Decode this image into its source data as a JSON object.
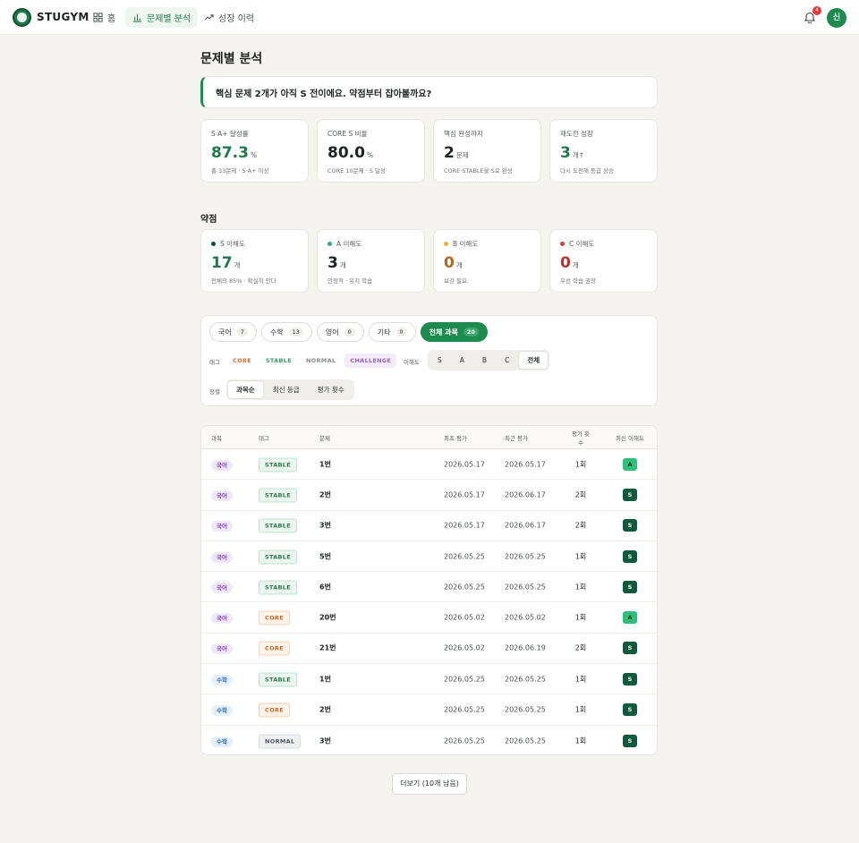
{
  "app": {
    "brand": "STUGYM",
    "notifications": "4",
    "avatar": "신"
  },
  "nav": [
    {
      "label": "홈",
      "icon": "grid-icon"
    },
    {
      "label": "문제별 분석",
      "icon": "bar-chart-icon"
    },
    {
      "label": "성장 이력",
      "icon": "trend-up-icon"
    }
  ],
  "page": {
    "title": "문제별 분석",
    "banner": "핵심 문제 2개가 아직 S 전이에요. 약점부터 잡아볼까요?"
  },
  "stats": [
    {
      "label": "S·A+ 달성률",
      "value": "87.3",
      "unit": "%",
      "sub": "총 33문제 · S·A+ 이상"
    },
    {
      "label": "CORE S 비율",
      "value": "80.0",
      "unit": "%",
      "sub": "CORE 10문제 · S 달성"
    },
    {
      "label": "핵심 완성까지",
      "value": "2",
      "unit": "문제",
      "sub": "CORE·STABLE을 S로 완성"
    },
    {
      "label": "재도전 성장",
      "value": "3",
      "unit": "개↑",
      "sub": "다시 도전해 등급 상승"
    }
  ],
  "weakness": {
    "title": "약점",
    "cards": [
      {
        "label": "S 이해도",
        "value": "17",
        "unit": "개",
        "sub": "전체의 85% · 확실히 안다",
        "color": "#124d33"
      },
      {
        "label": "A 이해도",
        "value": "3",
        "unit": "개",
        "sub": "안정적 · 유지 학습",
        "color": "#3aa877"
      },
      {
        "label": "B 이해도",
        "value": "0",
        "unit": "개",
        "sub": "보강 필요",
        "color": "#e8b335"
      },
      {
        "label": "C 이해도",
        "value": "0",
        "unit": "개",
        "sub": "우선 학습 권장",
        "color": "#c8413a"
      }
    ]
  },
  "filters": {
    "subjects": [
      {
        "label": "국어",
        "count": "7"
      },
      {
        "label": "수학",
        "count": "13"
      },
      {
        "label": "영어",
        "count": "0"
      },
      {
        "label": "기타",
        "count": "0"
      },
      {
        "label": "전체 과목",
        "count": "20"
      }
    ],
    "tag_label": "태그",
    "tags": [
      "CORE",
      "STABLE",
      "NORMAL",
      "CHALLENGE"
    ],
    "level_label": "이해도",
    "levels": [
      "S",
      "A",
      "B",
      "C",
      "전체"
    ],
    "sort_label": "정렬",
    "sorts": [
      "과목순",
      "최신 등급",
      "평가 횟수"
    ]
  },
  "table": {
    "headers": [
      "과목",
      "태그",
      "문제",
      "최초 평가",
      "최근 평가",
      "평가 횟수",
      "최신 이해도"
    ],
    "rows": [
      {
        "subject": "국어",
        "tag": "STABLE",
        "problem": "1번",
        "first": "2026.05.17",
        "last": "2026.05.17",
        "count": "1회",
        "level": "A"
      },
      {
        "subject": "국어",
        "tag": "STABLE",
        "problem": "2번",
        "first": "2026.05.17",
        "last": "2026.06.17",
        "count": "2회",
        "level": "S"
      },
      {
        "subject": "국어",
        "tag": "STABLE",
        "problem": "3번",
        "first": "2026.05.17",
        "last": "2026.06.17",
        "count": "2회",
        "level": "S"
      },
      {
        "subject": "국어",
        "tag": "STABLE",
        "problem": "5번",
        "first": "2026.05.25",
        "last": "2026.05.25",
        "count": "1회",
        "level": "S"
      },
      {
        "subject": "국어",
        "tag": "STABLE",
        "problem": "6번",
        "first": "2026.05.25",
        "last": "2026.05.25",
        "count": "1회",
        "level": "S"
      },
      {
        "subject": "국어",
        "tag": "CORE",
        "problem": "20번",
        "first": "2026.05.02",
        "last": "2026.05.02",
        "count": "1회",
        "level": "A"
      },
      {
        "subject": "국어",
        "tag": "CORE",
        "problem": "21번",
        "first": "2026.05.02",
        "last": "2026.06.19",
        "count": "2회",
        "level": "S"
      },
      {
        "subject": "수학",
        "tag": "STABLE",
        "problem": "1번",
        "first": "2026.05.25",
        "last": "2026.05.25",
        "count": "1회",
        "level": "S"
      },
      {
        "subject": "수학",
        "tag": "CORE",
        "problem": "2번",
        "first": "2026.05.25",
        "last": "2026.05.25",
        "count": "1회",
        "level": "S"
      },
      {
        "subject": "수학",
        "tag": "NORMAL",
        "problem": "3번",
        "first": "2026.05.25",
        "last": "2026.05.25",
        "count": "1회",
        "level": "S"
      }
    ]
  },
  "more_button": "더보기 (10개 남음)"
}
